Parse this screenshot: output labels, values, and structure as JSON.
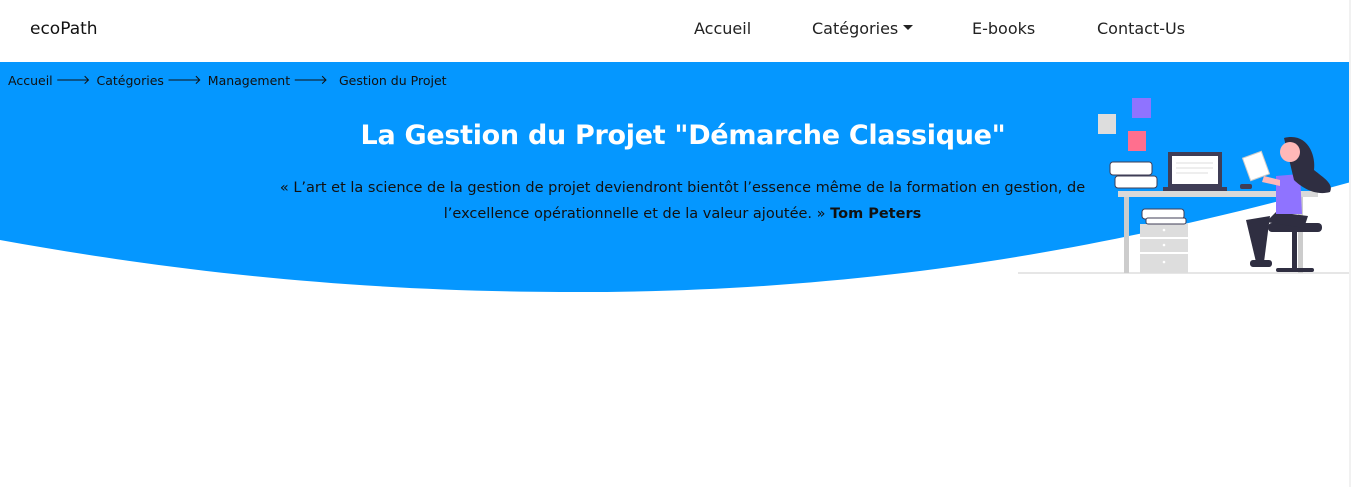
{
  "navbar": {
    "brand": "ecoPath",
    "links": {
      "home": "Accueil",
      "categories": "Catégories",
      "ebooks": "E-books",
      "contact": "Contact-Us"
    }
  },
  "breadcrumb": {
    "items": [
      "Accueil",
      "Catégories",
      "Management"
    ],
    "current": "Gestion du Projet"
  },
  "hero": {
    "title": "La Gestion du Projet \"Démarche Classique\"",
    "quote_text": "« L’art et la science de la gestion de projet deviendront bientôt l’essence même de la formation en gestion, de l’excellence opérationnelle et de la valeur ajoutée. »",
    "quote_author": "Tom Peters"
  },
  "colors": {
    "hero_blue": "#0597ff",
    "accent_purple": "#8f73ff",
    "accent_pink": "#ff6f8e"
  },
  "icons": {
    "breadcrumb_separator": "arrow-right-icon",
    "dropdown": "caret-down-icon"
  }
}
